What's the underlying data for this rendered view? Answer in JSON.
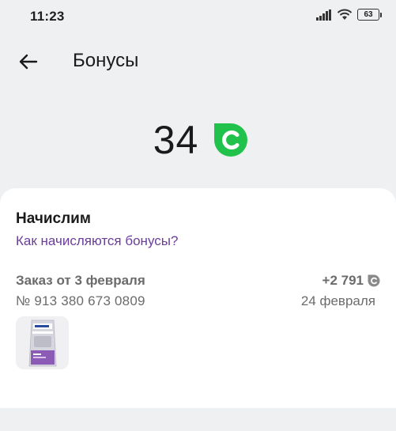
{
  "status_bar": {
    "time": "11:23",
    "battery_level": "63",
    "icons": [
      "signal-icon",
      "wifi-icon",
      "battery-icon"
    ]
  },
  "header": {
    "back_icon": "arrow-left-icon",
    "title": "Бонусы"
  },
  "balance": {
    "value": "34",
    "icon": "bonus-coin-icon",
    "accent_color": "#21c24b"
  },
  "accruals": {
    "title": "Начислим",
    "help_link": "Как начисляются бонусы?",
    "link_color": "#6b3d9b",
    "items": [
      {
        "title": "Заказ от 3 февраля",
        "number": "№ 913 380 673 0809",
        "amount": "+2 791",
        "amount_icon": "bonus-coin-icon",
        "date": "24 февраля",
        "product_image": "pet-food-bag-image"
      }
    ]
  }
}
